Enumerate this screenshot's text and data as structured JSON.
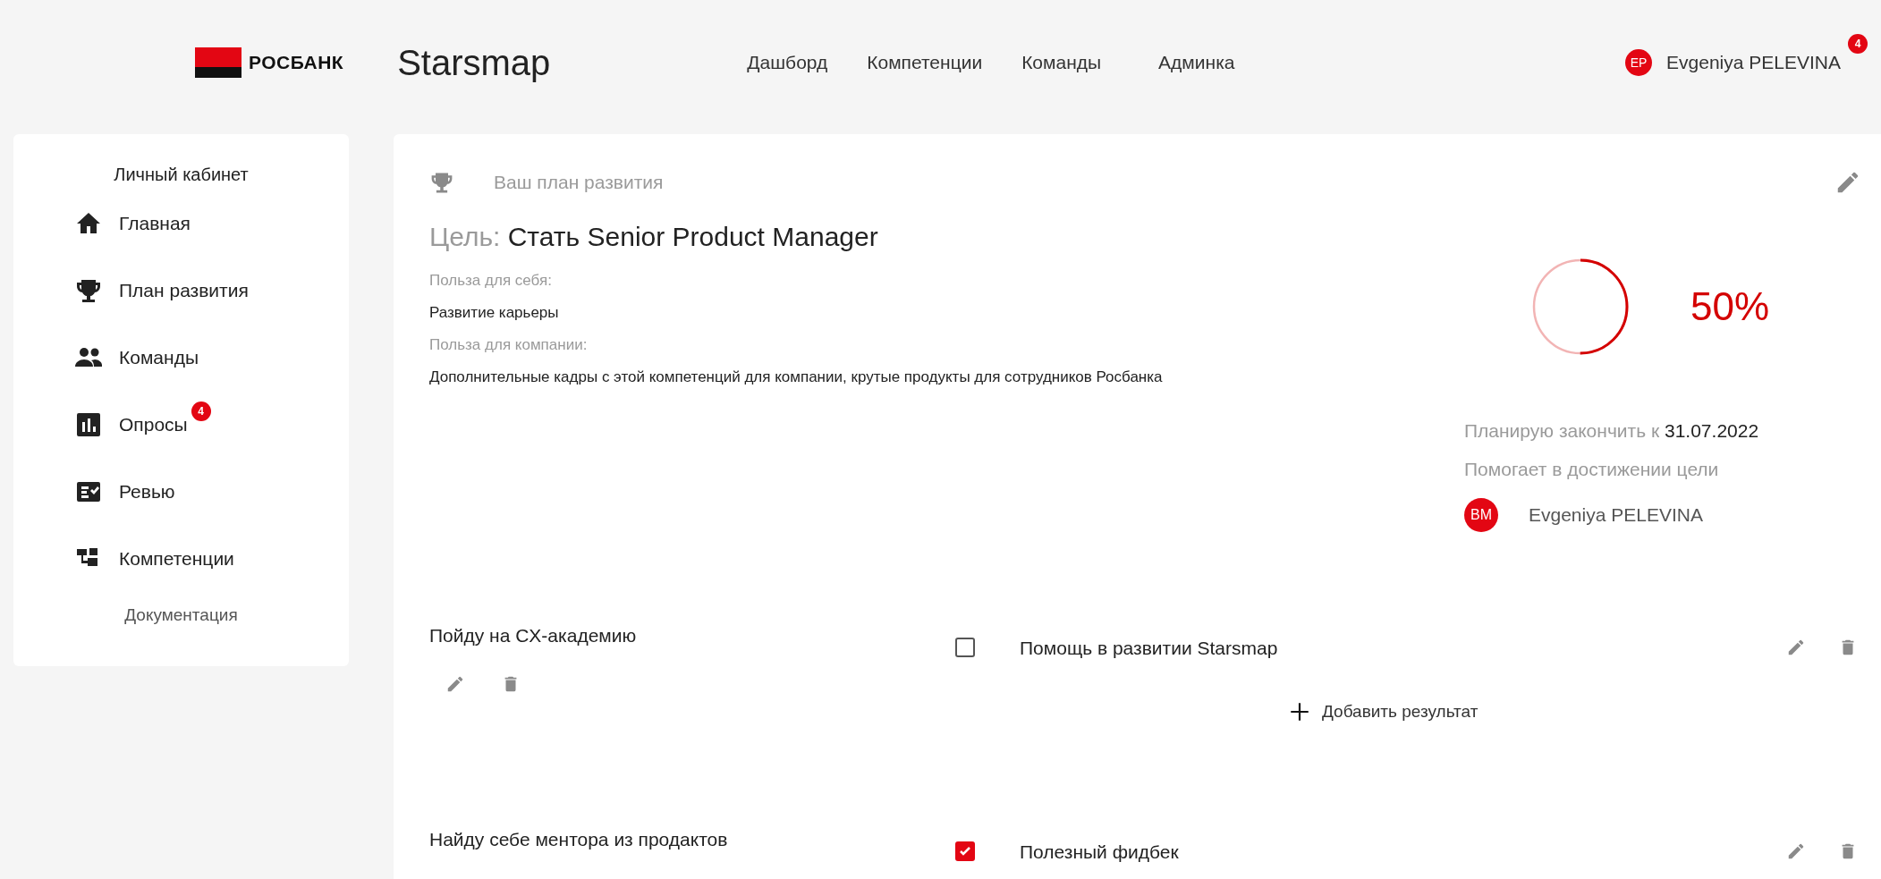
{
  "header": {
    "logo_text": "РОСБАНК",
    "app_name": "Starsmap",
    "nav": [
      {
        "label": "Дашборд"
      },
      {
        "label": "Компетенции"
      },
      {
        "label": "Команды"
      },
      {
        "label": "Админка"
      }
    ],
    "user": {
      "initials": "EP",
      "name": "Evgeniya PELEVINA",
      "badge": "4"
    }
  },
  "sidebar": {
    "title": "Личный кабинет",
    "items": [
      {
        "label": "Главная"
      },
      {
        "label": "План развития"
      },
      {
        "label": "Команды"
      },
      {
        "label": "Опросы",
        "badge": "4"
      },
      {
        "label": "Ревью"
      },
      {
        "label": "Компетенции"
      }
    ],
    "footer_link": "Документация"
  },
  "plan": {
    "header": "Ваш план развития",
    "goal_label": "Цель:",
    "goal": "Стать Senior Product Manager",
    "self_benefit_label": "Польза для себя:",
    "self_benefit": "Развитие карьеры",
    "company_benefit_label": "Польза для компании:",
    "company_benefit": "Дополнительные кадры с этой компетенций для компании, крутые продукты для сотрудников Росбанка",
    "progress": {
      "reading": "50%"
    },
    "finish_label": "Планирую закончить к",
    "finish_date": "31.07.2022",
    "helper_label": "Помогает в достижении цели",
    "helpers": [
      {
        "initials": "BM",
        "name": "Evgeniya PELEVINA"
      }
    ]
  },
  "tasks": [
    {
      "title": "Пойду на CX-академию",
      "results": [
        {
          "label": "Помощь в развитии Starsmap",
          "checked": false
        }
      ],
      "add_result": "Добавить результат"
    },
    {
      "title": "Найду себе ментора из продактов",
      "results": [
        {
          "label": "Полезный фидбек",
          "checked": true
        }
      ]
    }
  ]
}
